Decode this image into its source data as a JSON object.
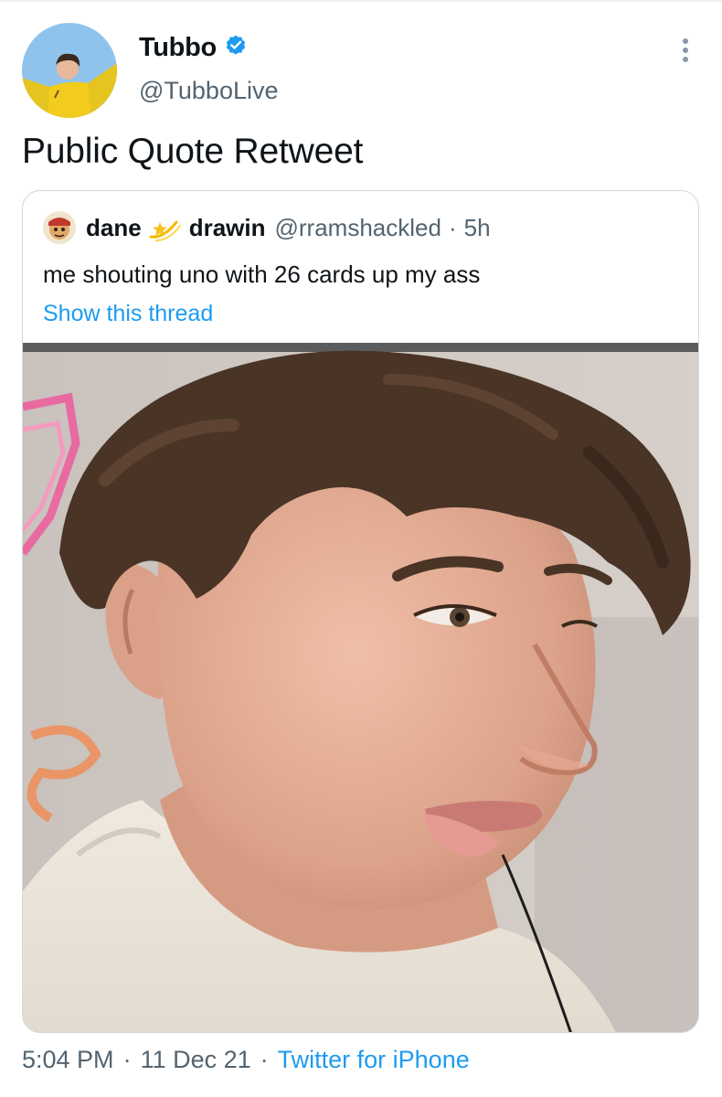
{
  "author": {
    "display_name": "Tubbo",
    "handle": "@TubboLive",
    "verified": true,
    "verified_color": "#1d9bf0"
  },
  "tweet": {
    "text": "Public Quote Retweet"
  },
  "quoted_tweet": {
    "name_part1": "dane",
    "name_part2": "drawin",
    "name_emoji": "star-emoji",
    "handle": "@rramshackled",
    "separator": "·",
    "time": "5h",
    "text": "me shouting uno with 26 cards up my ass",
    "show_thread_label": "Show this thread"
  },
  "footer": {
    "time": "5:04 PM",
    "separator": "·",
    "date": "11 Dec 21",
    "source": "Twitter for iPhone"
  },
  "colors": {
    "link": "#1d9bf0",
    "secondary_text": "#536471",
    "primary_text": "#0f1419",
    "border": "#cfd9de"
  }
}
